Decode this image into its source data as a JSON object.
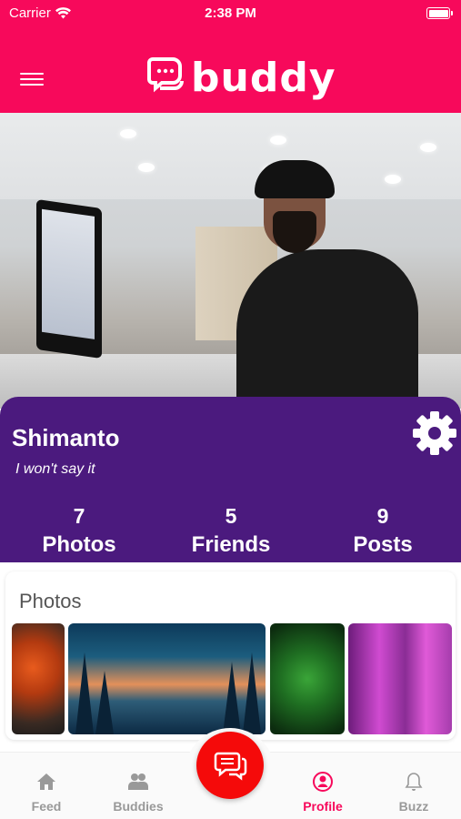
{
  "status_bar": {
    "carrier": "Carrier",
    "time": "2:38 PM"
  },
  "header": {
    "logo_text": "buddy",
    "brand_color": "#f7095b"
  },
  "profile": {
    "name": "Shimanto",
    "status": "I won't say it",
    "card_color": "#4b1a7e",
    "stats": [
      {
        "value": "7",
        "label": "Photos"
      },
      {
        "value": "5",
        "label": "Friends"
      },
      {
        "value": "9",
        "label": "Posts"
      }
    ]
  },
  "photos": {
    "title": "Photos"
  },
  "tabbar": {
    "tabs": [
      {
        "label": "Feed",
        "icon": "home-icon"
      },
      {
        "label": "Buddies",
        "icon": "users-icon"
      },
      {
        "label": "Profile",
        "icon": "profile-icon",
        "active": true
      },
      {
        "label": "Buzz",
        "icon": "bell-icon"
      }
    ],
    "fab_icon": "chat-icon",
    "active_color": "#f7095b"
  }
}
